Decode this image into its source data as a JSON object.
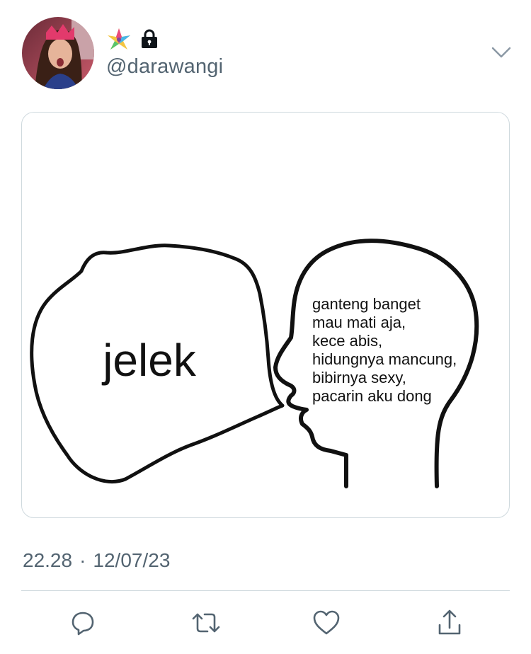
{
  "author": {
    "handle": "@darawangi",
    "badges": [
      "pinwheel-emoji",
      "lock-icon"
    ]
  },
  "meme": {
    "speech_text": "jelek",
    "thought_lines": [
      "ganteng banget",
      "mau mati aja,",
      "kece abis,",
      "hidungnya mancung,",
      "bibirnya sexy,",
      "pacarin aku dong"
    ]
  },
  "meta": {
    "time": "22.28",
    "separator": "·",
    "date": "12/07/23"
  },
  "actions": [
    "reply-icon",
    "retweet-icon",
    "like-icon",
    "share-icon"
  ],
  "colors": {
    "secondary_text": "#536471",
    "divider": "#cfd9de",
    "icon": "#536471"
  }
}
